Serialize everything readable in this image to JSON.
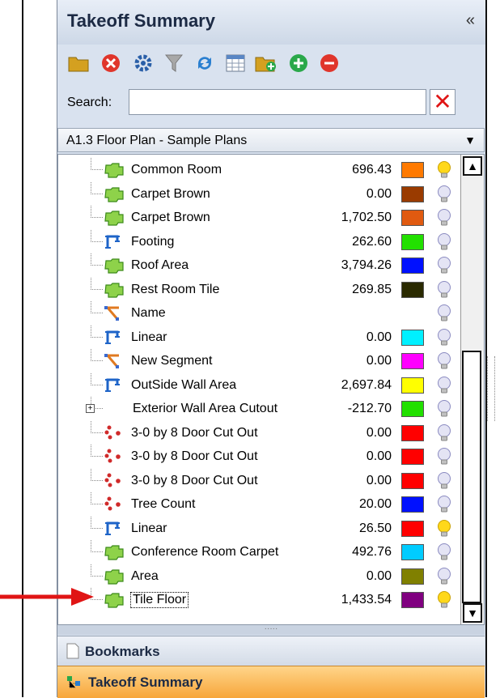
{
  "panel": {
    "title": "Takeoff Summary",
    "collapse_glyph": "«"
  },
  "toolbar": {
    "buttons": [
      {
        "icon": "folder-icon"
      },
      {
        "icon": "delete-icon"
      },
      {
        "icon": "settings-icon"
      },
      {
        "icon": "filter-icon"
      },
      {
        "icon": "refresh-icon"
      },
      {
        "icon": "grid-icon"
      },
      {
        "icon": "folder-new-icon"
      },
      {
        "icon": "add-icon"
      },
      {
        "icon": "remove-icon"
      }
    ]
  },
  "search": {
    "label": "Search:",
    "value": "",
    "placeholder": ""
  },
  "plan_selector": {
    "selected": "A1.3 Floor Plan - Sample Plans"
  },
  "tree": {
    "items": [
      {
        "name": "Common Room",
        "value": "696.43",
        "color": "#ff7a00",
        "type": "area",
        "bulb": "on"
      },
      {
        "name": "Carpet Brown",
        "value": "0.00",
        "color": "#9a3b00",
        "type": "area",
        "bulb": "off"
      },
      {
        "name": "Carpet Brown",
        "value": "1,702.50",
        "color": "#e05a10",
        "type": "area",
        "bulb": "off"
      },
      {
        "name": "Footing",
        "value": "262.60",
        "color": "#22e000",
        "type": "linear",
        "bulb": "off"
      },
      {
        "name": "Roof Area",
        "value": "3,794.26",
        "color": "#0010ff",
        "type": "area",
        "bulb": "off"
      },
      {
        "name": "Rest Room Tile",
        "value": "269.85",
        "color": "#2a2a00",
        "type": "area",
        "bulb": "off"
      },
      {
        "name": "Name",
        "value": "",
        "color": "",
        "type": "segment",
        "bulb": "off"
      },
      {
        "name": "Linear",
        "value": "0.00",
        "color": "#00f0ff",
        "type": "linear",
        "bulb": "off"
      },
      {
        "name": "New Segment",
        "value": "0.00",
        "color": "#ff00ff",
        "type": "segment",
        "bulb": "off"
      },
      {
        "name": "OutSide Wall Area",
        "value": "2,697.84",
        "color": "#ffff00",
        "type": "linear",
        "bulb": "off"
      },
      {
        "name": "Exterior Wall Area Cutout",
        "value": "-212.70",
        "color": "#22e000",
        "type": "group",
        "bulb": "off"
      },
      {
        "name": "3-0 by 8 Door Cut Out",
        "value": "0.00",
        "color": "#ff0000",
        "type": "count",
        "bulb": "off"
      },
      {
        "name": "3-0 by 8 Door Cut Out",
        "value": "0.00",
        "color": "#ff0000",
        "type": "count",
        "bulb": "off"
      },
      {
        "name": "3-0 by 8 Door Cut Out",
        "value": "0.00",
        "color": "#ff0000",
        "type": "count",
        "bulb": "off"
      },
      {
        "name": "Tree Count",
        "value": "20.00",
        "color": "#0010ff",
        "type": "count",
        "bulb": "off"
      },
      {
        "name": "Linear",
        "value": "26.50",
        "color": "#ff0000",
        "type": "linear",
        "bulb": "on"
      },
      {
        "name": "Conference Room Carpet",
        "value": "492.76",
        "color": "#00ccff",
        "type": "area",
        "bulb": "off"
      },
      {
        "name": "Area",
        "value": "0.00",
        "color": "#808000",
        "type": "area",
        "bulb": "off"
      },
      {
        "name": "Tile Floor",
        "value": "1,433.54",
        "color": "#800080",
        "type": "area",
        "bulb": "on",
        "selected": true
      }
    ]
  },
  "bottom_tabs": {
    "bookmarks": "Bookmarks",
    "takeoff_summary": "Takeoff Summary"
  },
  "colors": {
    "arrow": "#e01515",
    "active_tab": "#f7a63a"
  }
}
